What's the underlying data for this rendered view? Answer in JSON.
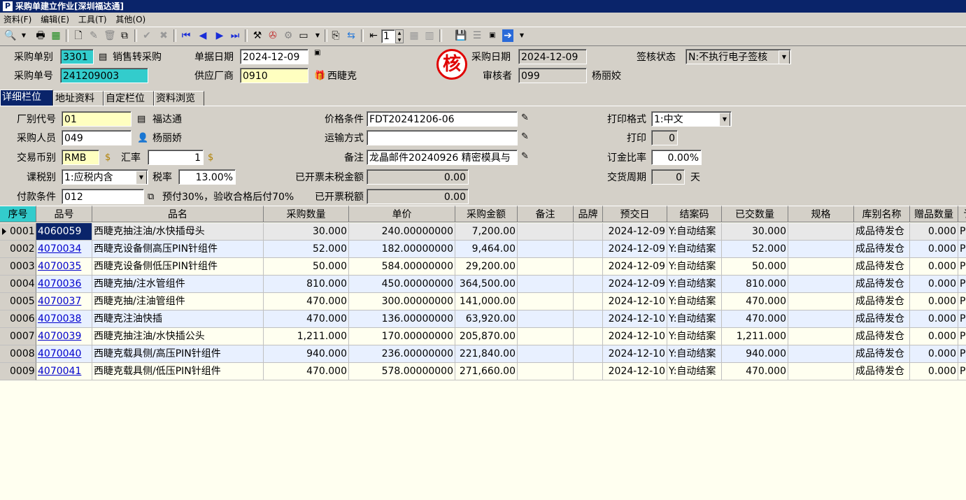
{
  "window": {
    "title": "采购单建立作业[深圳福达通]",
    "app_icon": "P"
  },
  "menu": [
    "资料(F)",
    "编辑(E)",
    "工具(T)",
    "其他(O)"
  ],
  "toolbar": {
    "page_value": "1"
  },
  "header": {
    "purchase_type_label": "采购单别",
    "purchase_type_value": "3301",
    "sales_to_purchase_label": "销售转采购",
    "purchase_no_label": "采购单号",
    "purchase_no_value": "241209003",
    "doc_date_label": "单据日期",
    "doc_date_value": "2024-12-09",
    "supplier_label": "供应厂商",
    "supplier_value": "0910",
    "supplier_name": "西睫克",
    "stamp_char": "核",
    "purchase_date_label": "采购日期",
    "purchase_date_value": "2024-12-09",
    "reviewer_label": "审核者",
    "reviewer_value": "099",
    "reviewer_name": "杨丽姣",
    "sign_status_label": "签核状态",
    "sign_status_value": "N:不执行电子签核"
  },
  "tabs": [
    "详细栏位",
    "地址资料",
    "自定栏位",
    "资料浏览"
  ],
  "detail": {
    "factory_code_label": "厂别代号",
    "factory_code_value": "01",
    "factory_name": "福达通",
    "buyer_label": "采购人员",
    "buyer_value": "049",
    "buyer_name": "杨丽娇",
    "currency_label": "交易币别",
    "currency_value": "RMB",
    "rate_label": "汇率",
    "rate_value": "1",
    "tax_type_label": "课税别",
    "tax_type_value": "1:应税内含",
    "tax_rate_label": "税率",
    "tax_rate_value": "13.00%",
    "payment_label": "付款条件",
    "payment_value": "012",
    "payment_desc": "预付30%，验收合格后付70%",
    "price_cond_label": "价格条件",
    "price_cond_value": "FDT20241206-06",
    "shipping_label": "运输方式",
    "shipping_value": "",
    "remark_label": "备注",
    "remark_value": "龙晶邮件20240926 精密模具与",
    "invoiced_untaxed_label": "已开票未税金额",
    "invoiced_untaxed_value": "0.00",
    "invoiced_tax_label": "已开票税额",
    "invoiced_tax_value": "0.00",
    "print_format_label": "打印格式",
    "print_format_value": "1:中文",
    "print_label": "打印",
    "print_value": "0",
    "deposit_label": "订金比率",
    "deposit_value": "0.00%",
    "delivery_label": "交货周期",
    "delivery_value": "0",
    "delivery_unit": "天"
  },
  "grid": {
    "columns": [
      "序号",
      "品号",
      "品名",
      "采购数量",
      "单价",
      "采购金额",
      "备注",
      "品牌",
      "预交日",
      "结案码",
      "已交数量",
      "规格",
      "库别名称",
      "赠品数量",
      "讠"
    ],
    "rows": [
      {
        "seq": "0001",
        "code": "4060059",
        "name": "西睫克抽注油/水快插母头",
        "qty": "30.000",
        "price": "240.00000000",
        "amount": "7,200.00",
        "remark": "",
        "brand": "",
        "due": "2024-12-09",
        "close": "Y:自动结案",
        "delivered": "30.000",
        "spec": "",
        "warehouse": "成品待发仓",
        "gift": "0.000",
        "extra": "P"
      },
      {
        "seq": "0002",
        "code": "4070034",
        "name": "西睫克设备侧高压PIN针组件",
        "qty": "52.000",
        "price": "182.00000000",
        "amount": "9,464.00",
        "remark": "",
        "brand": "",
        "due": "2024-12-09",
        "close": "Y:自动结案",
        "delivered": "52.000",
        "spec": "",
        "warehouse": "成品待发仓",
        "gift": "0.000",
        "extra": "P"
      },
      {
        "seq": "0003",
        "code": "4070035",
        "name": "西睫克设备侧低压PIN针组件",
        "qty": "50.000",
        "price": "584.00000000",
        "amount": "29,200.00",
        "remark": "",
        "brand": "",
        "due": "2024-12-09",
        "close": "Y:自动结案",
        "delivered": "50.000",
        "spec": "",
        "warehouse": "成品待发仓",
        "gift": "0.000",
        "extra": "P"
      },
      {
        "seq": "0004",
        "code": "4070036",
        "name": "西睫克抽/注水管组件",
        "qty": "810.000",
        "price": "450.00000000",
        "amount": "364,500.00",
        "remark": "",
        "brand": "",
        "due": "2024-12-09",
        "close": "Y:自动结案",
        "delivered": "810.000",
        "spec": "",
        "warehouse": "成品待发仓",
        "gift": "0.000",
        "extra": "P"
      },
      {
        "seq": "0005",
        "code": "4070037",
        "name": "西睫克抽/注油管组件",
        "qty": "470.000",
        "price": "300.00000000",
        "amount": "141,000.00",
        "remark": "",
        "brand": "",
        "due": "2024-12-10",
        "close": "Y:自动结案",
        "delivered": "470.000",
        "spec": "",
        "warehouse": "成品待发仓",
        "gift": "0.000",
        "extra": "P"
      },
      {
        "seq": "0006",
        "code": "4070038",
        "name": "西睫克注油快插",
        "qty": "470.000",
        "price": "136.00000000",
        "amount": "63,920.00",
        "remark": "",
        "brand": "",
        "due": "2024-12-10",
        "close": "Y:自动结案",
        "delivered": "470.000",
        "spec": "",
        "warehouse": "成品待发仓",
        "gift": "0.000",
        "extra": "P"
      },
      {
        "seq": "0007",
        "code": "4070039",
        "name": "西睫克抽注油/水快插公头",
        "qty": "1,211.000",
        "price": "170.00000000",
        "amount": "205,870.00",
        "remark": "",
        "brand": "",
        "due": "2024-12-10",
        "close": "Y:自动结案",
        "delivered": "1,211.000",
        "spec": "",
        "warehouse": "成品待发仓",
        "gift": "0.000",
        "extra": "P"
      },
      {
        "seq": "0008",
        "code": "4070040",
        "name": "西睫克载具侧/高压PIN针组件",
        "qty": "940.000",
        "price": "236.00000000",
        "amount": "221,840.00",
        "remark": "",
        "brand": "",
        "due": "2024-12-10",
        "close": "Y:自动结案",
        "delivered": "940.000",
        "spec": "",
        "warehouse": "成品待发仓",
        "gift": "0.000",
        "extra": "P"
      },
      {
        "seq": "0009",
        "code": "4070041",
        "name": "西睫克载具侧/低压PIN针组件",
        "qty": "470.000",
        "price": "578.00000000",
        "amount": "271,660.00",
        "remark": "",
        "brand": "",
        "due": "2024-12-10",
        "close": "Y:自动结案",
        "delivered": "470.000",
        "spec": "",
        "warehouse": "成品待发仓",
        "gift": "0.000",
        "extra": "P"
      }
    ]
  }
}
